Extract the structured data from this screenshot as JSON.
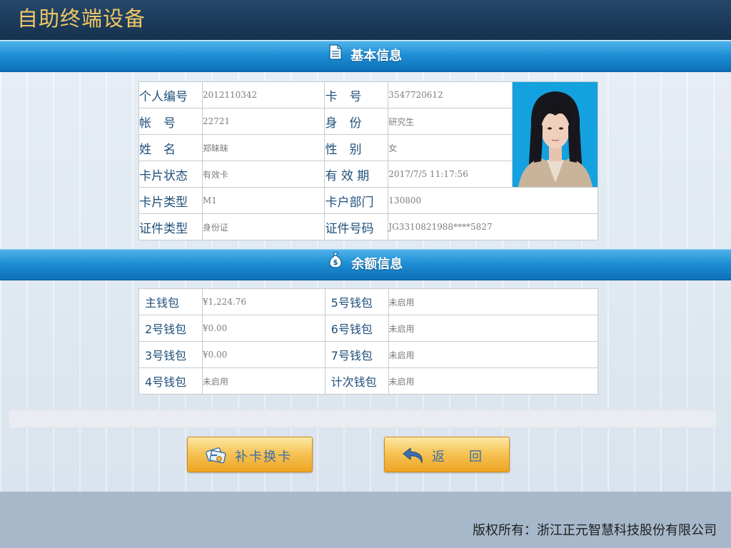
{
  "app": {
    "title": "自助终端设备"
  },
  "sections": {
    "basic": "基本信息",
    "balance": "余额信息"
  },
  "basic_info": {
    "personal_no_label": "个人编号",
    "personal_no": "2012110342",
    "card_no_label": "卡　号",
    "card_no": "3547720612",
    "account_label": "帐　号",
    "account": "22721",
    "identity_label": "身　份",
    "identity": "研究生",
    "name_label": "姓　名",
    "name": "郑昧昧",
    "gender_label": "性　别",
    "gender": "女",
    "card_status_label": "卡片状态",
    "card_status": "有效卡",
    "valid_until_label": "有 效 期",
    "valid_until": "2017/7/5 11:17:56",
    "card_type_label": "卡片类型",
    "card_type": "M1",
    "department_label": "卡户部门",
    "department": "130800",
    "id_type_label": "证件类型",
    "id_type": "身份证",
    "id_number_label": "证件号码",
    "id_number": "JG3310821988****5827"
  },
  "balance_info": {
    "main_wallet_label": "主钱包",
    "main_wallet": "¥1,224.76",
    "wallet5_label": "5号钱包",
    "wallet5": "未启用",
    "wallet2_label": "2号钱包",
    "wallet2": "¥0.00",
    "wallet6_label": "6号钱包",
    "wallet6": "未启用",
    "wallet3_label": "3号钱包",
    "wallet3": "¥0.00",
    "wallet7_label": "7号钱包",
    "wallet7": "未启用",
    "wallet4_label": "4号钱包",
    "wallet4": "未启用",
    "count_wallet_label": "计次钱包",
    "count_wallet": "未启用"
  },
  "buttons": {
    "reissue": "补卡换卡",
    "return": "返回"
  },
  "footer": {
    "copyright": "版权所有：浙江正元智慧科技股份有限公司"
  },
  "colors": {
    "title_gold": "#f0c766",
    "section_blue": "#1f8fd5",
    "button_orange": "#f6c457"
  },
  "icons": [
    "document-icon",
    "money-bag-icon",
    "card-swap-icon",
    "return-arrow-icon"
  ]
}
